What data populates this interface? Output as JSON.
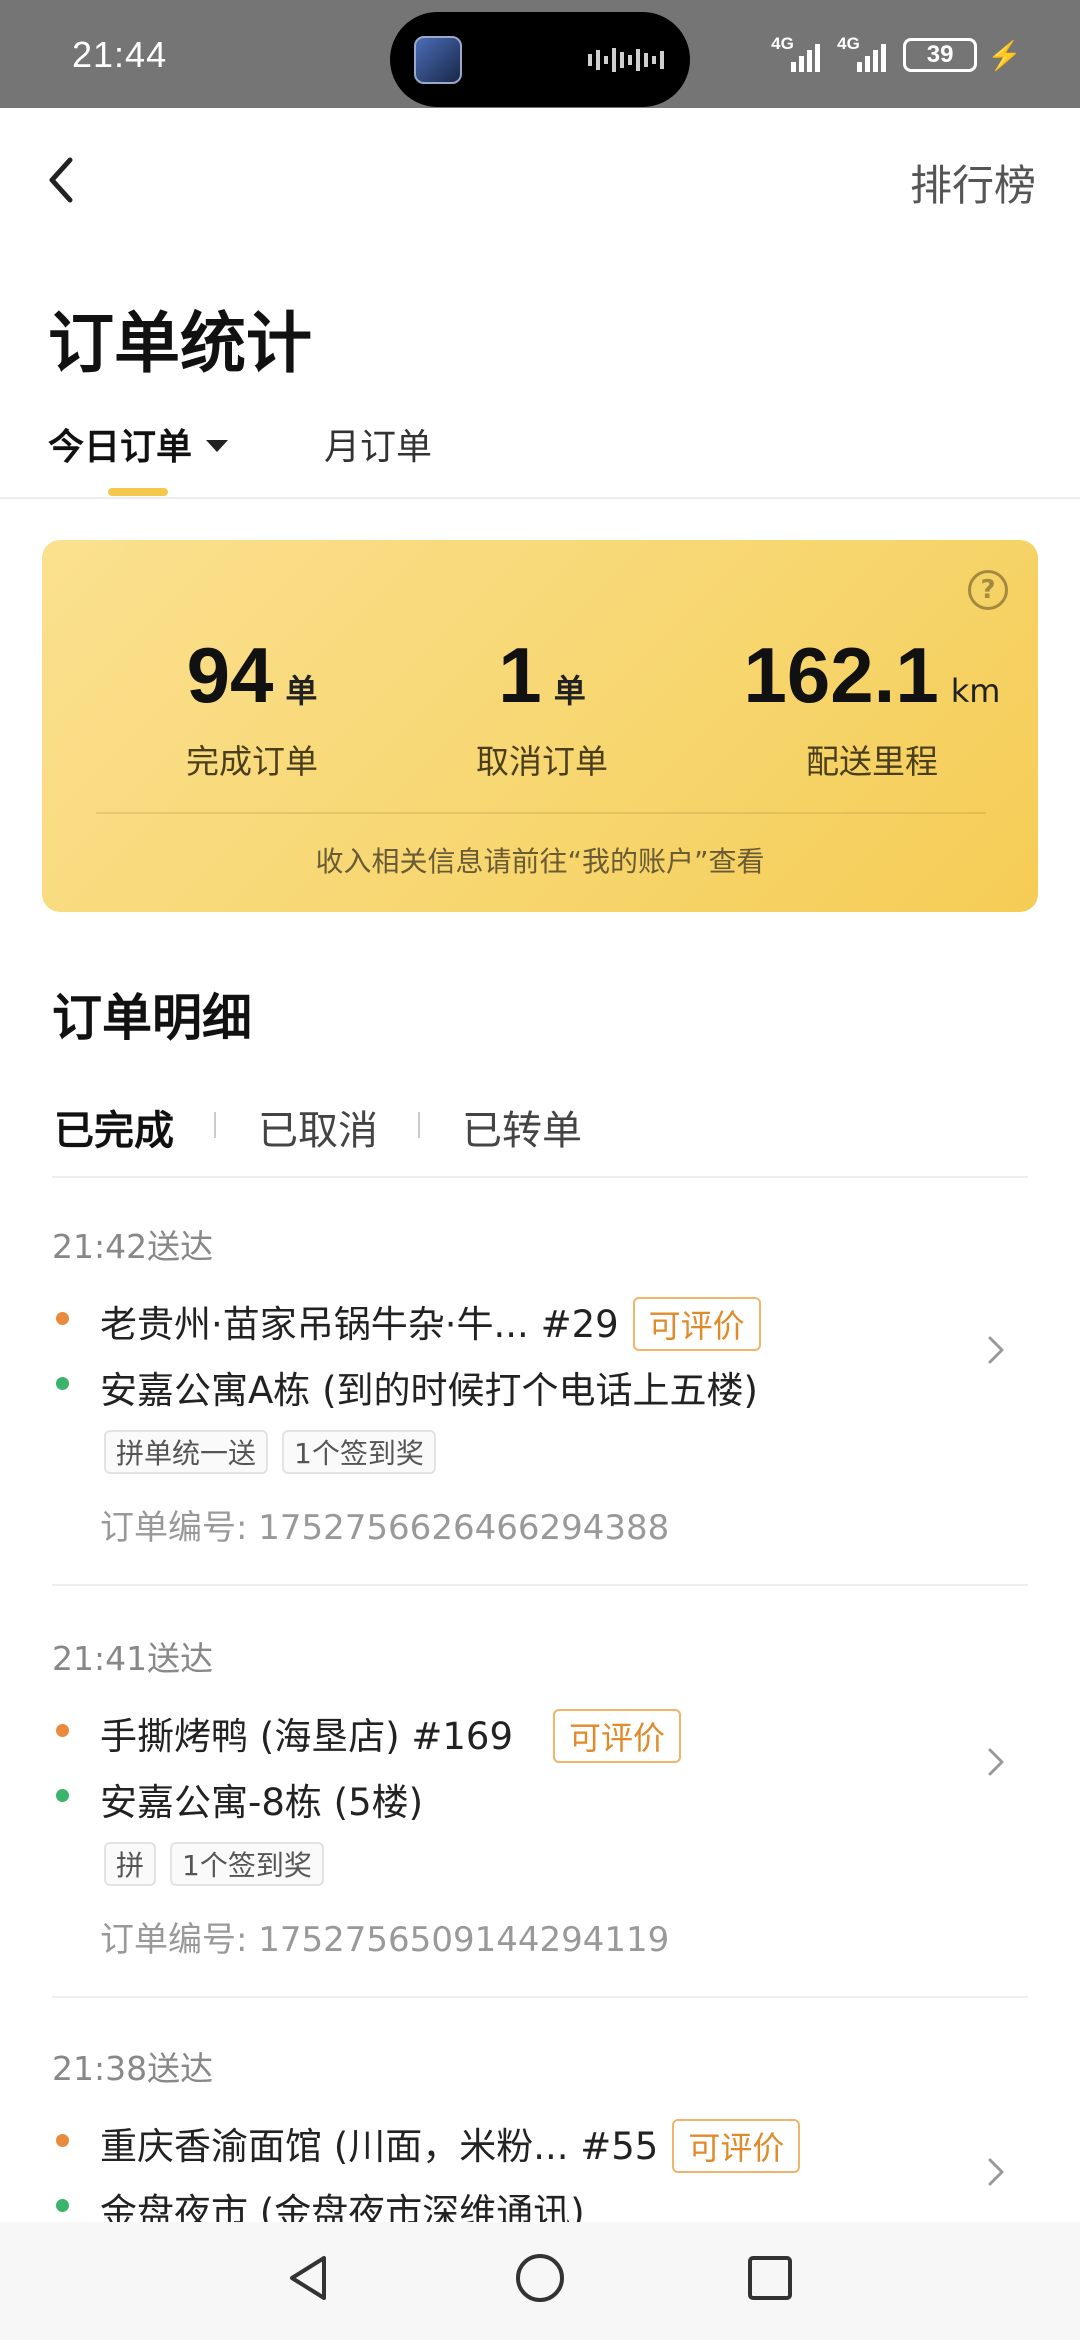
{
  "status_bar": {
    "time": "21:44",
    "network_1": "4G",
    "network_2": "4G",
    "battery": "39"
  },
  "header": {
    "back_icon": "chevron-left-icon",
    "ranking_label": "排行榜",
    "title": "订单统计"
  },
  "tabs": {
    "today": "今日订单",
    "month": "月订单"
  },
  "stats": {
    "completed": {
      "value": "94",
      "unit": "单",
      "label": "完成订单"
    },
    "cancelled": {
      "value": "1",
      "unit": "单",
      "label": "取消订单"
    },
    "distance": {
      "value": "162.1",
      "unit": "km",
      "label": "配送里程"
    },
    "help_icon": "question-circle-icon",
    "note": "收入相关信息请前往“我的账户”查看"
  },
  "detail": {
    "title": "订单明细",
    "subtabs": [
      "已完成",
      "已取消",
      "已转单"
    ]
  },
  "orders": [
    {
      "time": "21:42送达",
      "shop": "老贵州·苗家吊锅牛杂·牛... #29",
      "review": "可评价",
      "address": "安嘉公寓A栋 (到的时候打个电话上五楼)",
      "tags": [
        "拼单统一送",
        "1个签到奖"
      ],
      "order_no": "订单编号: 1752756626466294388"
    },
    {
      "time": "21:41送达",
      "shop": "手撕烤鸭 (海垦店) #169",
      "review": "可评价",
      "address": "安嘉公寓-8栋 (5楼)",
      "tags": [
        "拼",
        "1个签到奖"
      ],
      "order_no": "订单编号: 1752756509144294119"
    },
    {
      "time": "21:38送达",
      "shop": "重庆香渝面馆 (川面，米粉... #55",
      "review": "可评价",
      "address": "金盘夜市 (金盘夜市深维通讯)"
    }
  ],
  "colors": {
    "accent_yellow": "#f2c94c",
    "card_gradient_start": "#fbe08f",
    "card_gradient_end": "#f5cc55",
    "shop_dot": "#ea8a3d",
    "address_dot": "#39b46a",
    "review_text": "#e08a2a"
  }
}
